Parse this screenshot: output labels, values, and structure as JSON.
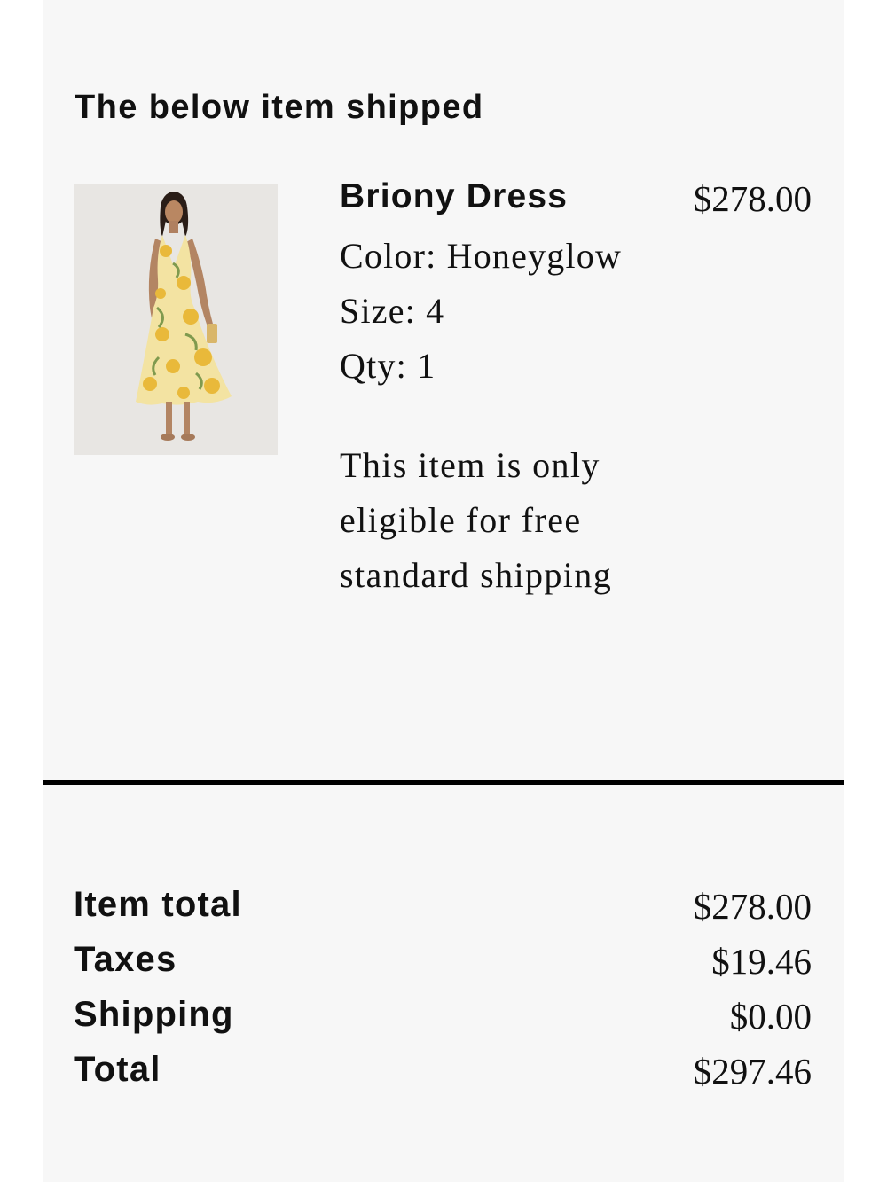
{
  "heading": "The below item shipped",
  "product": {
    "image_alt": "Woman wearing a yellow floral halter midi dress",
    "name": "Briony Dress",
    "price": "$278.00",
    "color_line": "Color: Honeyglow",
    "size_line": "Size: 4",
    "qty_line": "Qty: 1",
    "shipping_note": "This item is only eligible for free standard shipping"
  },
  "summary": {
    "item_total_label": "Item total",
    "item_total_value": "$278.00",
    "taxes_label": "Taxes",
    "taxes_value": "$19.46",
    "shipping_label": "Shipping",
    "shipping_value": "$0.00",
    "total_label": "Total",
    "total_value": "$297.46"
  },
  "colors": {
    "page_background": "#ffffff",
    "card_background": "#f7f7f7",
    "text": "#111111",
    "divider": "#000000",
    "dress_base": "#f3e3a2",
    "dress_flower": "#e9b93a",
    "dress_leaf": "#7f9a4e"
  }
}
